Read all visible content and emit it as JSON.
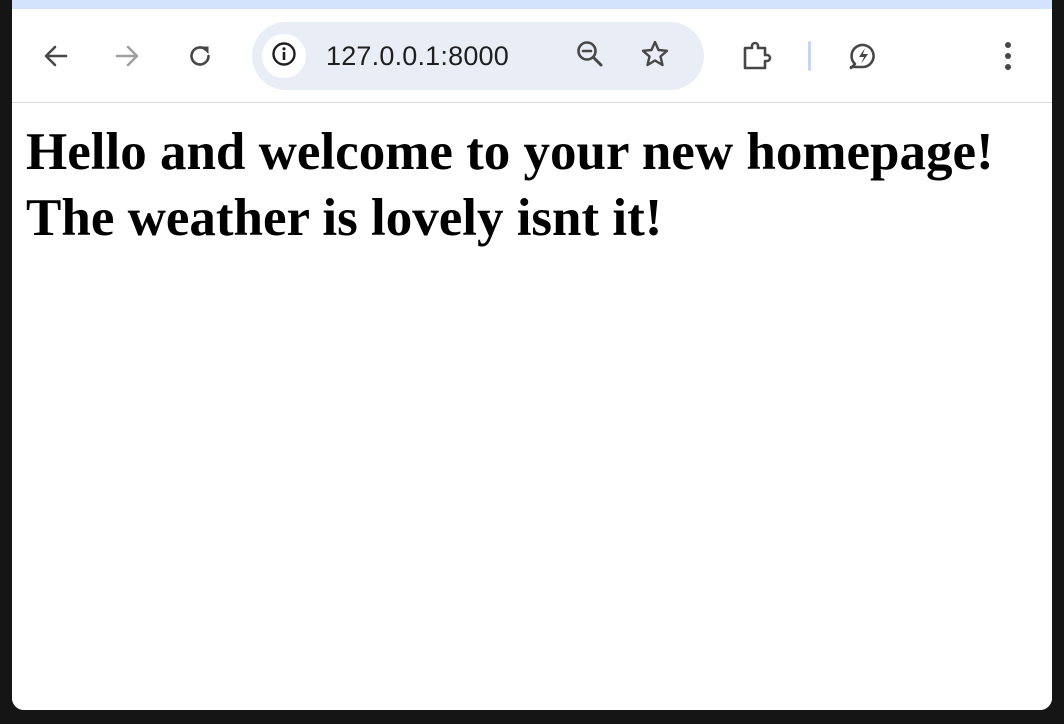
{
  "browser": {
    "address_bar": {
      "url": "127.0.0.1:8000"
    },
    "toolbar": {
      "icons": {
        "back": "back-arrow-icon",
        "forward": "forward-arrow-icon",
        "reload": "reload-icon",
        "site_info": "info-icon",
        "zoom": "zoom-out-icon",
        "bookmark": "star-icon",
        "extensions": "puzzle-icon",
        "performance": "energy-saver-icon",
        "menu": "kebab-menu-icon"
      },
      "forward_enabled": false
    },
    "colors": {
      "frame": "#d3e3fd",
      "omnibox_bg": "#e9edf6",
      "icon": "#474747",
      "icon_disabled": "#a0a0a0"
    }
  },
  "page": {
    "heading": "Hello and welcome to your new homepage! The weather is lovely isnt it!"
  }
}
